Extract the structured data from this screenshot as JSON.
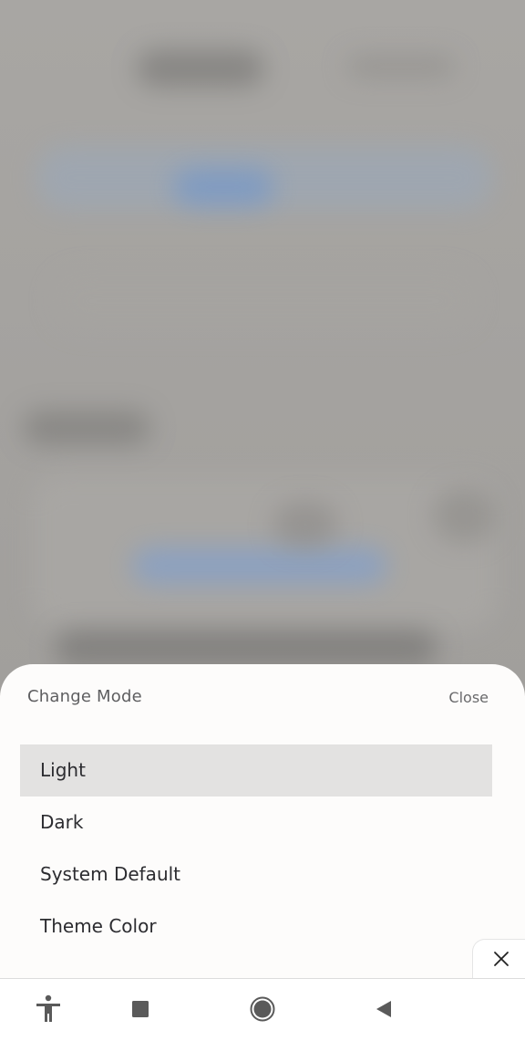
{
  "sheet": {
    "title": "Change Mode",
    "close_label": "Close",
    "options": [
      {
        "label": "Light",
        "selected": true
      },
      {
        "label": "Dark",
        "selected": false
      },
      {
        "label": "System Default",
        "selected": false
      },
      {
        "label": "Theme Color",
        "selected": false
      }
    ]
  },
  "icons": {
    "floating_close": "close-icon",
    "nav": [
      "accessibility-icon",
      "recents-icon",
      "home-icon",
      "back-icon"
    ]
  },
  "colors": {
    "sheet_bg": "#fdfcfb",
    "selected_bg": "#e3e2e1",
    "text": "#2c2c30",
    "muted_text": "#5e5e60"
  }
}
